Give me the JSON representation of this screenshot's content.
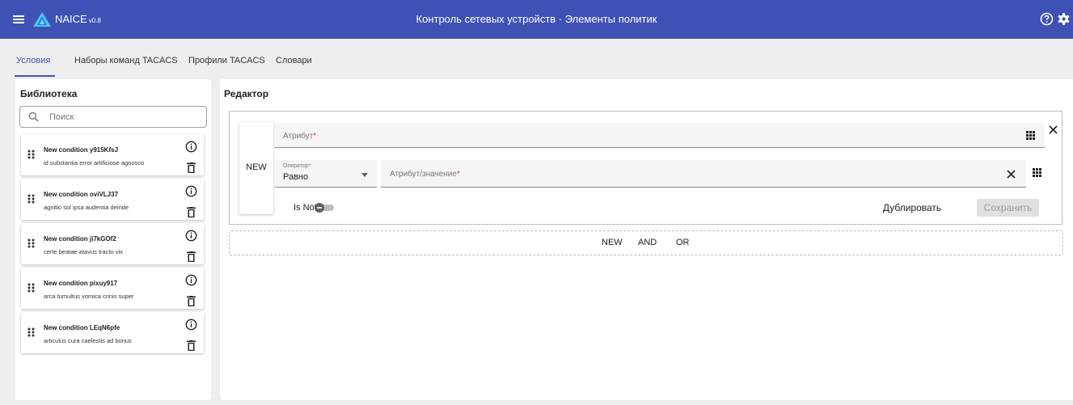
{
  "app": {
    "name": "NAICE",
    "version": "v0.8",
    "page_title": "Контроль сетевых устройств · Элементы политик",
    "accent_color": "#3f51b5"
  },
  "tabs": [
    {
      "label": "Условия",
      "active": true
    },
    {
      "label": "Наборы команд TACACS",
      "active": false
    },
    {
      "label": "Профили TACACS",
      "active": false
    },
    {
      "label": "Словари",
      "active": false
    }
  ],
  "library": {
    "title": "Библиотека",
    "search_placeholder": "Поиск",
    "items": [
      {
        "name": "New condition y915KfsJ",
        "description": "id substantia error artificiose agnosco"
      },
      {
        "name": "New condition oviVLJ37",
        "description": "agnitio sol ipsa audentia deinde"
      },
      {
        "name": "New condition ji7kGOf2",
        "description": "certe beatae atavus tracto vix"
      },
      {
        "name": "New condition pixuy917",
        "description": "arca tumultus vomica crinis super"
      },
      {
        "name": "New condition LEqN6pfe",
        "description": "articulus cura caelestis ad bonus"
      }
    ]
  },
  "editor": {
    "title": "Редактор",
    "new_label": "NEW",
    "attribute_label": "Атрибут",
    "operator_label": "Оператор",
    "operator_value": "Равно",
    "value_label": "Атрибут/значение",
    "required_mark": "*",
    "is_not_label": "Is Not",
    "is_not_checked": false,
    "duplicate_label": "Дублировать",
    "save_label": "Сохранить",
    "add_new_label": "NEW",
    "add_and_label": "AND",
    "add_or_label": "OR"
  }
}
